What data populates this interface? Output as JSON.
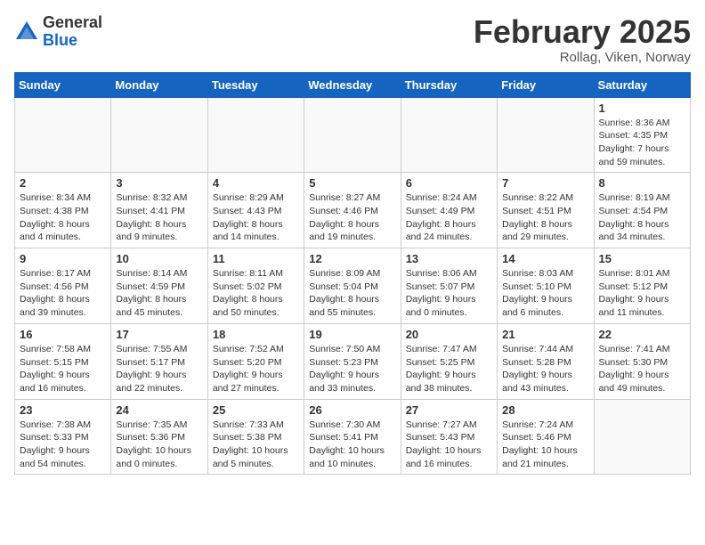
{
  "logo": {
    "general": "General",
    "blue": "Blue"
  },
  "title": {
    "month_year": "February 2025",
    "location": "Rollag, Viken, Norway"
  },
  "weekdays": [
    "Sunday",
    "Monday",
    "Tuesday",
    "Wednesday",
    "Thursday",
    "Friday",
    "Saturday"
  ],
  "weeks": [
    [
      {
        "day": "",
        "info": ""
      },
      {
        "day": "",
        "info": ""
      },
      {
        "day": "",
        "info": ""
      },
      {
        "day": "",
        "info": ""
      },
      {
        "day": "",
        "info": ""
      },
      {
        "day": "",
        "info": ""
      },
      {
        "day": "1",
        "info": "Sunrise: 8:36 AM\nSunset: 4:35 PM\nDaylight: 7 hours and 59 minutes."
      }
    ],
    [
      {
        "day": "2",
        "info": "Sunrise: 8:34 AM\nSunset: 4:38 PM\nDaylight: 8 hours and 4 minutes."
      },
      {
        "day": "3",
        "info": "Sunrise: 8:32 AM\nSunset: 4:41 PM\nDaylight: 8 hours and 9 minutes."
      },
      {
        "day": "4",
        "info": "Sunrise: 8:29 AM\nSunset: 4:43 PM\nDaylight: 8 hours and 14 minutes."
      },
      {
        "day": "5",
        "info": "Sunrise: 8:27 AM\nSunset: 4:46 PM\nDaylight: 8 hours and 19 minutes."
      },
      {
        "day": "6",
        "info": "Sunrise: 8:24 AM\nSunset: 4:49 PM\nDaylight: 8 hours and 24 minutes."
      },
      {
        "day": "7",
        "info": "Sunrise: 8:22 AM\nSunset: 4:51 PM\nDaylight: 8 hours and 29 minutes."
      },
      {
        "day": "8",
        "info": "Sunrise: 8:19 AM\nSunset: 4:54 PM\nDaylight: 8 hours and 34 minutes."
      }
    ],
    [
      {
        "day": "9",
        "info": "Sunrise: 8:17 AM\nSunset: 4:56 PM\nDaylight: 8 hours and 39 minutes."
      },
      {
        "day": "10",
        "info": "Sunrise: 8:14 AM\nSunset: 4:59 PM\nDaylight: 8 hours and 45 minutes."
      },
      {
        "day": "11",
        "info": "Sunrise: 8:11 AM\nSunset: 5:02 PM\nDaylight: 8 hours and 50 minutes."
      },
      {
        "day": "12",
        "info": "Sunrise: 8:09 AM\nSunset: 5:04 PM\nDaylight: 8 hours and 55 minutes."
      },
      {
        "day": "13",
        "info": "Sunrise: 8:06 AM\nSunset: 5:07 PM\nDaylight: 9 hours and 0 minutes."
      },
      {
        "day": "14",
        "info": "Sunrise: 8:03 AM\nSunset: 5:10 PM\nDaylight: 9 hours and 6 minutes."
      },
      {
        "day": "15",
        "info": "Sunrise: 8:01 AM\nSunset: 5:12 PM\nDaylight: 9 hours and 11 minutes."
      }
    ],
    [
      {
        "day": "16",
        "info": "Sunrise: 7:58 AM\nSunset: 5:15 PM\nDaylight: 9 hours and 16 minutes."
      },
      {
        "day": "17",
        "info": "Sunrise: 7:55 AM\nSunset: 5:17 PM\nDaylight: 9 hours and 22 minutes."
      },
      {
        "day": "18",
        "info": "Sunrise: 7:52 AM\nSunset: 5:20 PM\nDaylight: 9 hours and 27 minutes."
      },
      {
        "day": "19",
        "info": "Sunrise: 7:50 AM\nSunset: 5:23 PM\nDaylight: 9 hours and 33 minutes."
      },
      {
        "day": "20",
        "info": "Sunrise: 7:47 AM\nSunset: 5:25 PM\nDaylight: 9 hours and 38 minutes."
      },
      {
        "day": "21",
        "info": "Sunrise: 7:44 AM\nSunset: 5:28 PM\nDaylight: 9 hours and 43 minutes."
      },
      {
        "day": "22",
        "info": "Sunrise: 7:41 AM\nSunset: 5:30 PM\nDaylight: 9 hours and 49 minutes."
      }
    ],
    [
      {
        "day": "23",
        "info": "Sunrise: 7:38 AM\nSunset: 5:33 PM\nDaylight: 9 hours and 54 minutes."
      },
      {
        "day": "24",
        "info": "Sunrise: 7:35 AM\nSunset: 5:36 PM\nDaylight: 10 hours and 0 minutes."
      },
      {
        "day": "25",
        "info": "Sunrise: 7:33 AM\nSunset: 5:38 PM\nDaylight: 10 hours and 5 minutes."
      },
      {
        "day": "26",
        "info": "Sunrise: 7:30 AM\nSunset: 5:41 PM\nDaylight: 10 hours and 10 minutes."
      },
      {
        "day": "27",
        "info": "Sunrise: 7:27 AM\nSunset: 5:43 PM\nDaylight: 10 hours and 16 minutes."
      },
      {
        "day": "28",
        "info": "Sunrise: 7:24 AM\nSunset: 5:46 PM\nDaylight: 10 hours and 21 minutes."
      },
      {
        "day": "",
        "info": ""
      }
    ]
  ]
}
